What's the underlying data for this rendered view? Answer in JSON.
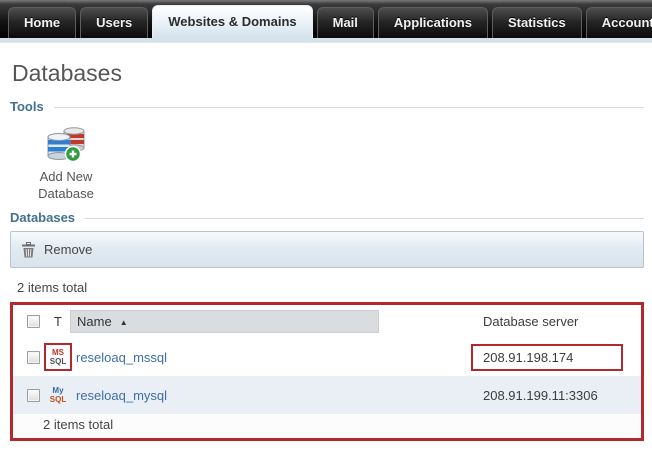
{
  "nav": {
    "tabs": [
      {
        "label": "Home",
        "active": false
      },
      {
        "label": "Users",
        "active": false
      },
      {
        "label": "Websites & Domains",
        "active": true
      },
      {
        "label": "Mail",
        "active": false
      },
      {
        "label": "Applications",
        "active": false
      },
      {
        "label": "Statistics",
        "active": false
      },
      {
        "label": "Account",
        "active": false
      }
    ]
  },
  "page": {
    "title": "Databases"
  },
  "tools_section": {
    "label": "Tools",
    "add_button": {
      "line1": "Add New",
      "line2": "Database"
    }
  },
  "databases_section": {
    "label": "Databases",
    "toolbar": {
      "remove_label": "Remove"
    },
    "items_total_top": "2 items total",
    "items_total_bottom": "2 items total",
    "table": {
      "headers": {
        "type": "T",
        "name": "Name",
        "server": "Database server"
      },
      "sort_icon": "▲",
      "rows": [
        {
          "type_line1": "MS",
          "type_line2": "SQL",
          "name": "reseloaq_mssql",
          "server": "208.91.198.174"
        },
        {
          "type_line1": "My",
          "type_line2": "SQL",
          "name": "reseloaq_mysql",
          "server": "208.91.199.11:3306"
        }
      ]
    }
  },
  "colors": {
    "annotation_red": "#b3282d",
    "link_blue": "#3f6fa8",
    "section_teal": "#41718f",
    "active_tab_bg": "#d3e2eb"
  }
}
